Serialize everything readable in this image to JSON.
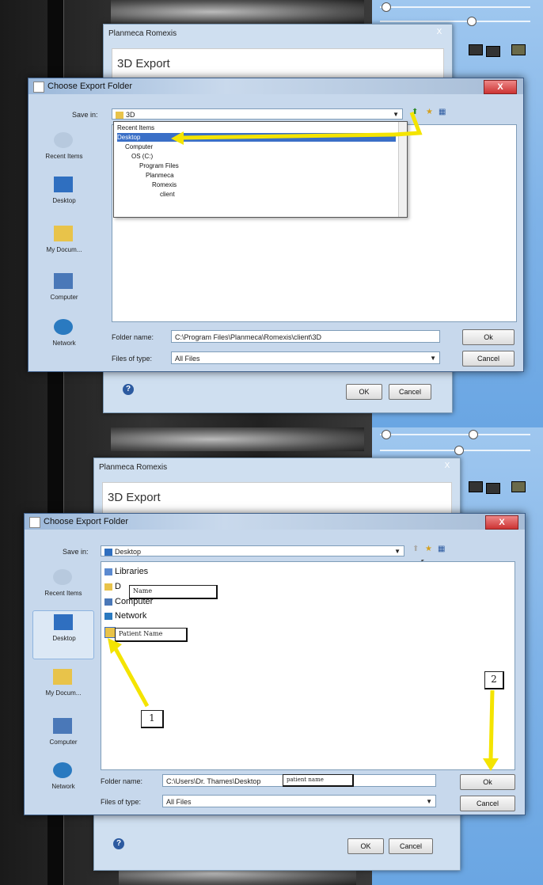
{
  "colors": {
    "arrow": "#f4e400",
    "dialog_bg": "#c7d8ec",
    "selection": "#3a6fc7",
    "close_red": "#c33333"
  },
  "top": {
    "romexis": {
      "title": "Planmeca Romexis",
      "close": "X",
      "heading": "3D Export",
      "help": "?",
      "ok": "OK",
      "cancel": "Cancel"
    },
    "dialog": {
      "title": "Choose Export Folder",
      "close": "X",
      "save_in_label": "Save in:",
      "save_in_value": "3D",
      "places": [
        "Recent Items",
        "Desktop",
        "My Docum...",
        "Computer",
        "Network"
      ],
      "dropdown_items": [
        "Recent Items",
        "Desktop",
        "Computer",
        "OS (C:)",
        "Program Files",
        "Planmeca",
        "Romexis",
        "client"
      ],
      "folder_name_label": "Folder name:",
      "folder_name_value": "C:\\Program Files\\Planmeca\\Romexis\\client\\3D",
      "files_of_type_label": "Files of type:",
      "files_of_type_value": "All Files",
      "ok": "Ok",
      "cancel": "Cancel"
    }
  },
  "bottom": {
    "romexis": {
      "title": "Planmeca Romexis",
      "close": "X",
      "heading": "3D Export",
      "help": "?",
      "ok": "OK",
      "cancel": "Cancel"
    },
    "dialog": {
      "title": "Choose Export Folder",
      "close": "X",
      "save_in_label": "Save in:",
      "save_in_value": "Desktop",
      "places": [
        "Recent Items",
        "Desktop",
        "My Docum...",
        "Computer",
        "Network"
      ],
      "file_items": [
        "Libraries",
        "D",
        "Computer",
        "Network"
      ],
      "name_callout": "Name",
      "patient_callout": "Patient Name",
      "folder_name_label": "Folder name:",
      "folder_name_value": "C:\\Users\\Dr. Thames\\Desktop",
      "folder_name_callout": "patient name",
      "files_of_type_label": "Files of type:",
      "files_of_type_value": "All Files",
      "ok": "Ok",
      "cancel": "Cancel"
    },
    "step1": "1",
    "step2": "2"
  }
}
